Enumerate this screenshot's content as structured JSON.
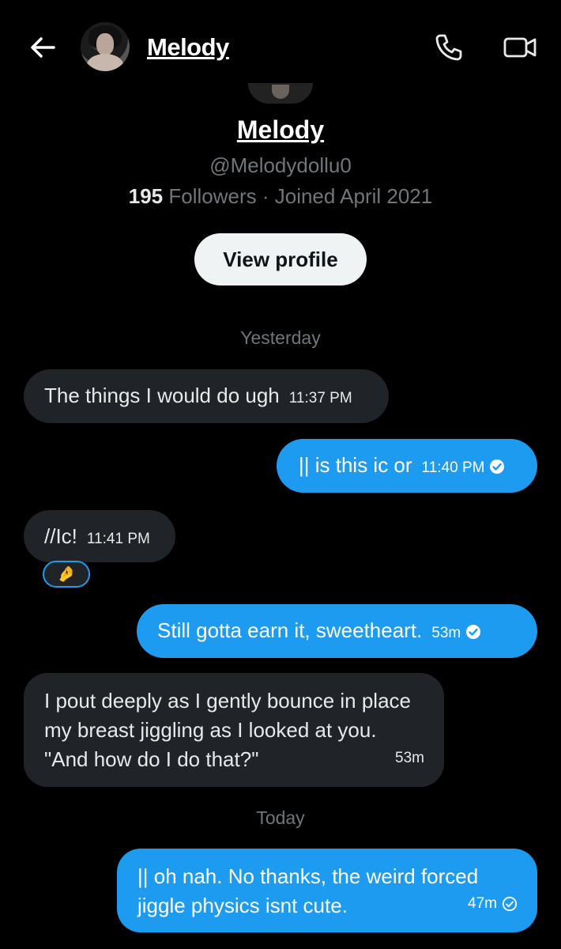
{
  "header": {
    "back_icon": "arrow-left-icon",
    "name": "Melody",
    "call_icon": "phone-icon",
    "video_icon": "video-camera-icon"
  },
  "profile": {
    "name": "Melody",
    "handle": "@Melodydollu0",
    "followers_count": "195",
    "followers_label": " Followers · Joined April 2021",
    "view_profile_label": "View profile"
  },
  "dates": {
    "yesterday": "Yesterday",
    "today": "Today"
  },
  "messages": [
    {
      "text": "The things I would do ugh",
      "time": "11:37 PM",
      "direction": "in"
    },
    {
      "text": "|| is this ic or",
      "time": "11:40 PM",
      "direction": "out",
      "status": "read"
    },
    {
      "text": "//Ic!",
      "time": "11:41 PM",
      "direction": "in",
      "reaction": "🤌"
    },
    {
      "text": "Still gotta earn it, sweetheart.",
      "time": "53m",
      "direction": "out",
      "status": "read"
    },
    {
      "text": "I pout deeply as I gently bounce in place my breast jiggling as I looked at you. \"And how do I do that?\"",
      "time": "53m",
      "direction": "in"
    },
    {
      "text": "|| oh nah. No thanks, the weird forced jiggle physics isnt cute.",
      "time": "47m",
      "direction": "out",
      "status": "sent"
    }
  ],
  "colors": {
    "background": "#000000",
    "incoming_bubble": "#202327",
    "outgoing_bubble": "#1d9bf0",
    "muted_text": "#71767b"
  }
}
